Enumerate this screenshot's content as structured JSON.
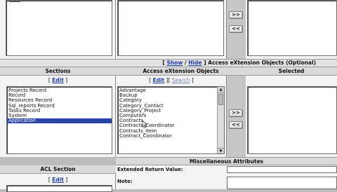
{
  "top_section": {
    "move_right_label": ">>",
    "move_left_label": "<<"
  },
  "toggle_bar": {
    "open_bracket": "[",
    "show_label": "Show",
    "separator": "/",
    "hide_label": "Hide",
    "close_bracket": "]",
    "title": "Access eXtension Objects (Optional)"
  },
  "columns": {
    "sections": {
      "header": "Sections",
      "edit_label": "Edit",
      "items": [
        "Projects Record",
        "Record",
        "Resources Record",
        "Sql_reports Record",
        "Tasks Record",
        "System",
        "Application"
      ],
      "selected_index": 6
    },
    "objects": {
      "header": "Access eXtension Objects",
      "edit_label": "Edit",
      "search_label": "Search",
      "items": [
        "Advantage",
        "Backup",
        "Category",
        "Category_Contact",
        "Category_Project",
        "Computers",
        "Contracts",
        "Contracts_Coordinator",
        "Contracts_Item",
        "Contract_Coordinator"
      ]
    },
    "selected": {
      "header": "Selected",
      "move_right_label": ">>",
      "move_left_label": "<<"
    }
  },
  "misc": {
    "header": "Miscellaneous Attributes",
    "acl_header": "ACL Section",
    "acl_edit_label": "Edit",
    "extended_return_label": "Extended Return Value:",
    "note_label": "Note:",
    "extended_return_value": "",
    "note_value": ""
  }
}
